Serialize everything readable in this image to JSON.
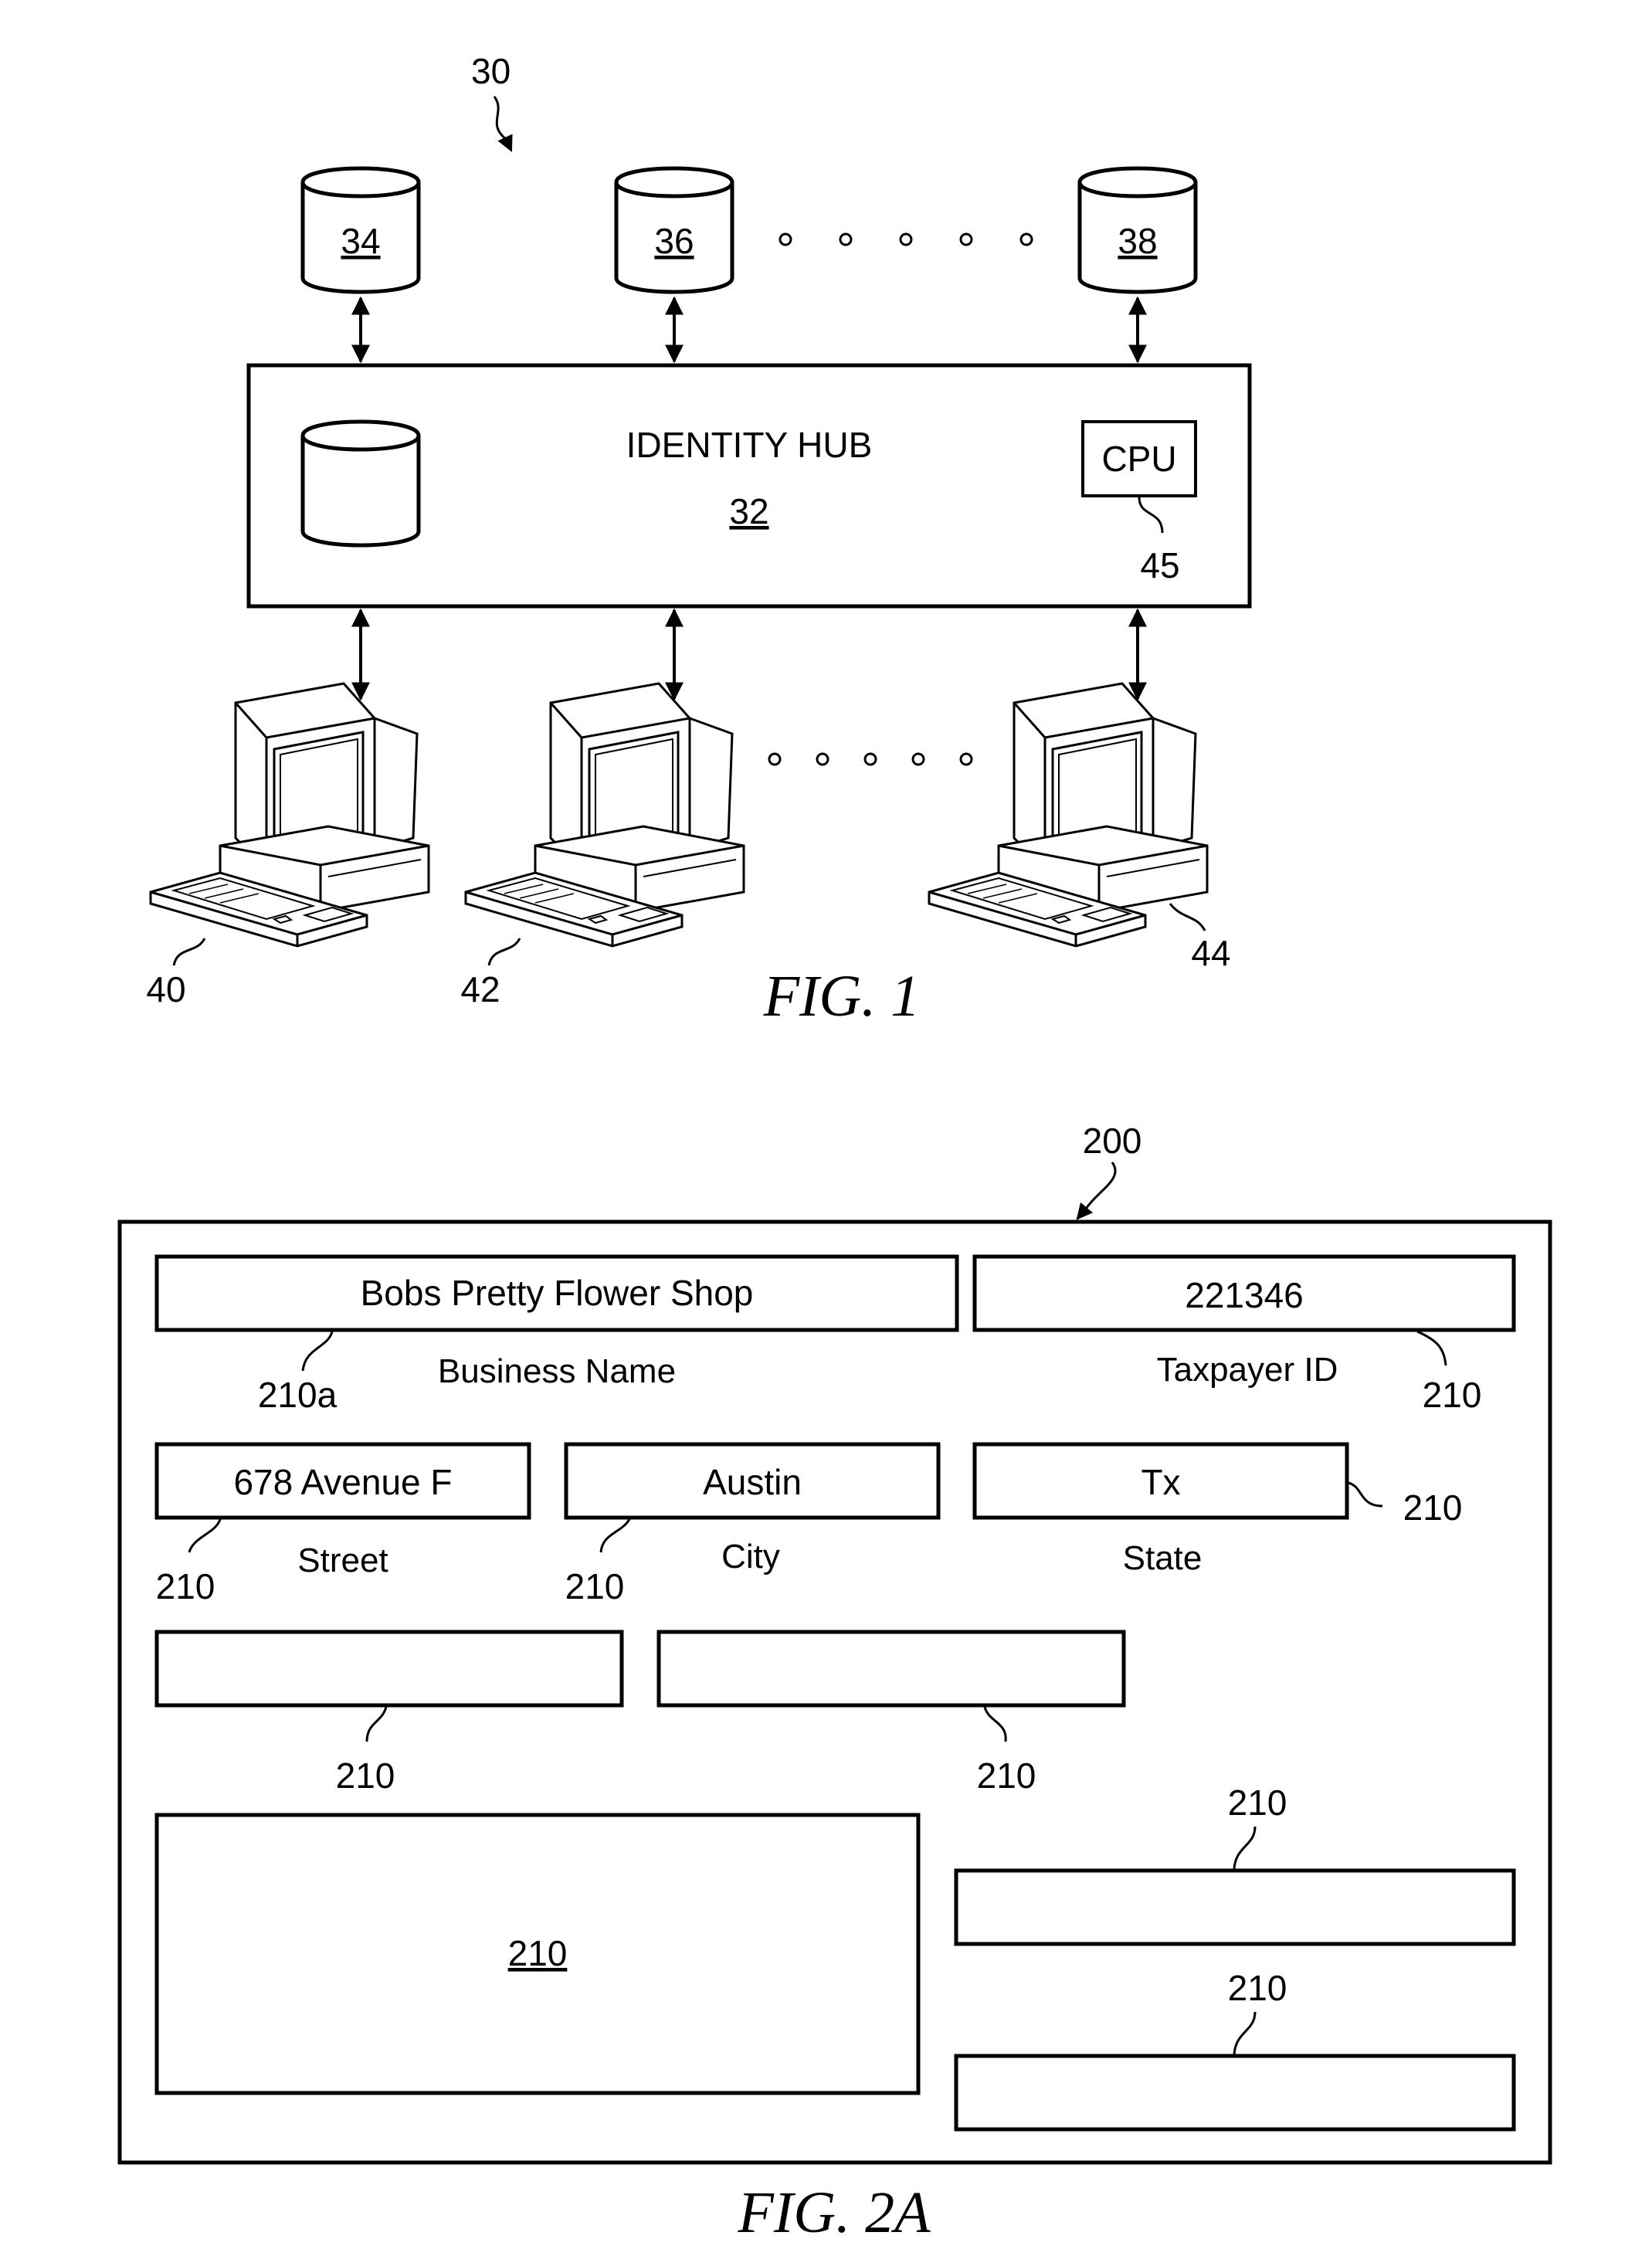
{
  "fig1": {
    "ref_system": "30",
    "databases": [
      {
        "label": "34"
      },
      {
        "label": "36"
      },
      {
        "label": "38"
      }
    ],
    "hub": {
      "title": "IDENTITY HUB",
      "ref": "32",
      "cpu_label": "CPU",
      "cpu_ref": "45"
    },
    "computers": [
      {
        "ref": "40"
      },
      {
        "ref": "42"
      },
      {
        "ref": "44"
      }
    ],
    "caption": "FIG. 1"
  },
  "fig2a": {
    "ref_form": "200",
    "fields": [
      {
        "value": "Bobs Pretty Flower Shop",
        "label": "Business Name",
        "ref": "210a"
      },
      {
        "value": "221346",
        "label": "Taxpayer ID",
        "ref": "210"
      },
      {
        "value": "678 Avenue F",
        "label": "Street",
        "ref": "210"
      },
      {
        "value": "Austin",
        "label": "City",
        "ref": "210"
      },
      {
        "value": "Tx",
        "label": "State",
        "ref": "210"
      },
      {
        "value": "",
        "label": "",
        "ref": "210"
      },
      {
        "value": "",
        "label": "",
        "ref": "210"
      },
      {
        "value": "210",
        "label": "",
        "ref": ""
      },
      {
        "value": "",
        "label": "",
        "ref": "210"
      },
      {
        "value": "",
        "label": "",
        "ref": "210"
      }
    ],
    "caption": "FIG. 2A"
  }
}
